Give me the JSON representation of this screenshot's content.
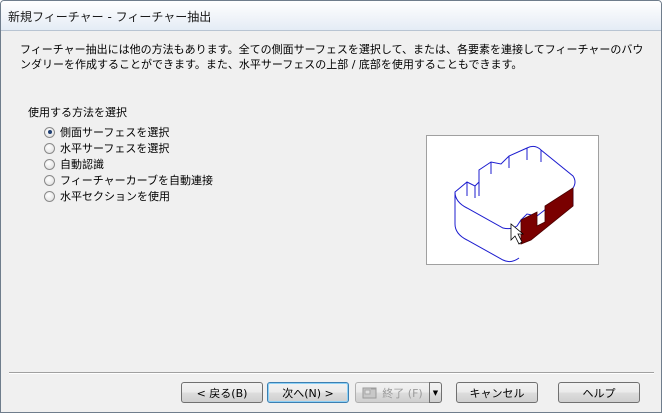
{
  "window": {
    "title": "新規フィーチャー - フィーチャー抽出"
  },
  "description": "フィーチャー抽出には他の方法もあります。全ての側面サーフェスを選択して、または、各要素を連接してフィーチャーのバウンダリーを作成することができます。また、水平サーフェスの上部 / 底部を使用することもできます。",
  "method_group": {
    "label": "使用する方法を選択",
    "options": [
      {
        "label": "側面サーフェスを選択",
        "selected": true
      },
      {
        "label": "水平サーフェスを選択",
        "selected": false
      },
      {
        "label": "自動認識",
        "selected": false
      },
      {
        "label": "フィーチャーカーブを自動連接",
        "selected": false
      },
      {
        "label": "水平セクションを使用",
        "selected": false
      }
    ]
  },
  "preview": {
    "icon": "feature-wireframe-with-highlighted-side-faces",
    "highlight_color": "#7a0000",
    "wire_color": "#1c1ccf"
  },
  "buttons": {
    "back": "< 戻る(B)",
    "next": "次へ(N) >",
    "finish": "終了 (F)",
    "cancel": "キャンセル",
    "help": "ヘルプ"
  },
  "colors": {
    "dialog_bg": "#f0f0f0"
  }
}
